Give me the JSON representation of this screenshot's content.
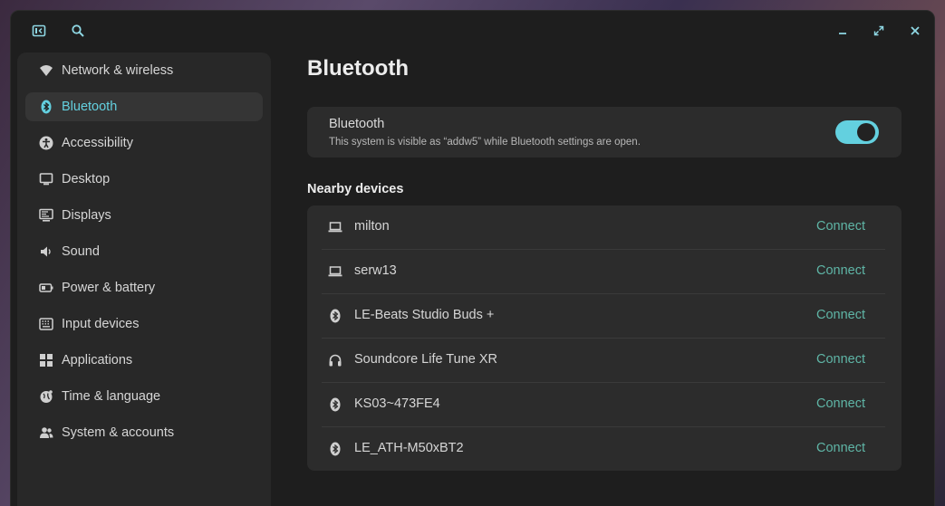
{
  "window": {
    "controls": {
      "minimize_icon": "minimize-icon",
      "maximize_icon": "maximize-icon",
      "close_icon": "close-icon"
    }
  },
  "sidebar": {
    "items": [
      {
        "label": "Network & wireless",
        "icon": "wifi-icon",
        "active": false
      },
      {
        "label": "Bluetooth",
        "icon": "bluetooth-icon",
        "active": true
      },
      {
        "label": "Accessibility",
        "icon": "accessibility-icon",
        "active": false
      },
      {
        "label": "Desktop",
        "icon": "desktop-icon",
        "active": false
      },
      {
        "label": "Displays",
        "icon": "displays-icon",
        "active": false
      },
      {
        "label": "Sound",
        "icon": "speaker-icon",
        "active": false
      },
      {
        "label": "Power & battery",
        "icon": "battery-icon",
        "active": false
      },
      {
        "label": "Input devices",
        "icon": "keyboard-icon",
        "active": false
      },
      {
        "label": "Applications",
        "icon": "grid-icon",
        "active": false
      },
      {
        "label": "Time & language",
        "icon": "globe-icon",
        "active": false
      },
      {
        "label": "System & accounts",
        "icon": "users-icon",
        "active": false
      }
    ]
  },
  "main": {
    "title": "Bluetooth",
    "bluetooth_card": {
      "title": "Bluetooth",
      "subtitle": "This system is visible as “addw5” while Bluetooth settings are open.",
      "enabled": true
    },
    "nearby_title": "Nearby devices",
    "devices": [
      {
        "name": "milton",
        "icon": "laptop-icon",
        "action": "Connect"
      },
      {
        "name": "serw13",
        "icon": "laptop-icon",
        "action": "Connect"
      },
      {
        "name": "LE-Beats Studio Buds +",
        "icon": "bluetooth-icon",
        "action": "Connect"
      },
      {
        "name": "Soundcore Life Tune XR",
        "icon": "headphones-icon",
        "action": "Connect"
      },
      {
        "name": "KS03~473FE4",
        "icon": "bluetooth-icon",
        "action": "Connect"
      },
      {
        "name": "LE_ATH-M50xBT2",
        "icon": "bluetooth-icon",
        "action": "Connect"
      }
    ]
  },
  "colors": {
    "accent": "#63d0df",
    "connect": "#5fb5a6",
    "window_bg": "#1e1e1e",
    "card_bg": "#2c2c2c"
  }
}
